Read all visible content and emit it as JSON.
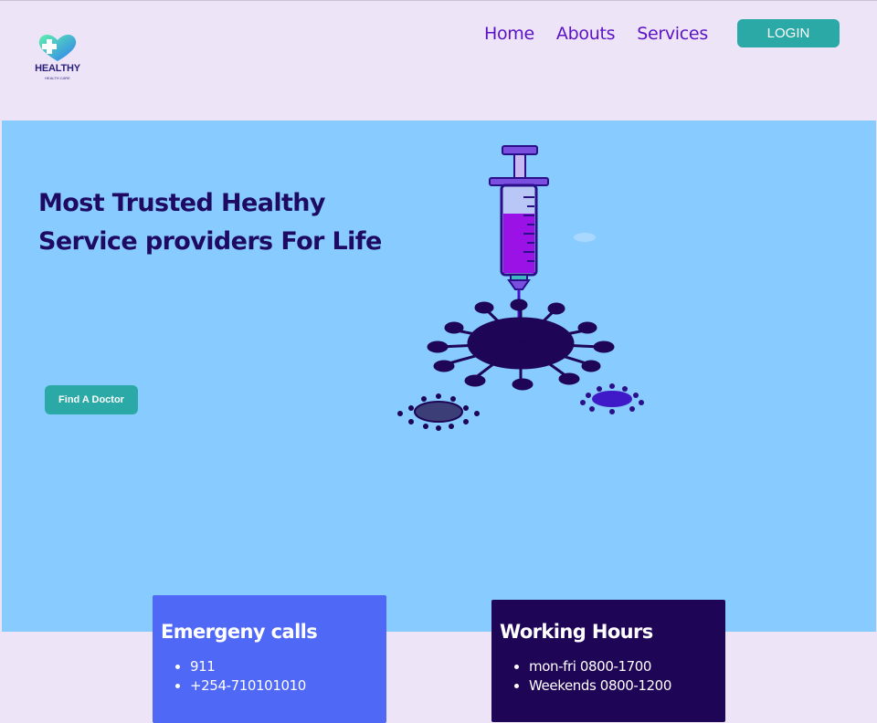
{
  "brand": {
    "name": "HEALTHY",
    "tagline": "HEALTH CARE",
    "icon": "heart-cross-logo"
  },
  "nav": {
    "items": [
      {
        "label": "Home"
      },
      {
        "label": "Abouts"
      },
      {
        "label": "Services"
      }
    ],
    "login_label": "LOGIN"
  },
  "hero": {
    "title": "Most Trusted Healthy Service providers For Life",
    "cta_label": "Find A Doctor",
    "illustration": "syringe-virus-illustration"
  },
  "cards": {
    "emergency": {
      "title": "Emergeny calls",
      "items": [
        "911",
        "+254-710101010"
      ]
    },
    "hours": {
      "title": "Working Hours",
      "items": [
        "mon-fri 0800-1700",
        "Weekends 0800-1200"
      ]
    }
  },
  "colors": {
    "page_bg": "#ede4f7",
    "hero_bg": "#87cbff",
    "accent": "#2aa9a6",
    "nav_text": "#5b12c7",
    "title_text": "#1e0a63",
    "card_emergency": "#4f68f5",
    "card_hours": "#1e0556"
  }
}
